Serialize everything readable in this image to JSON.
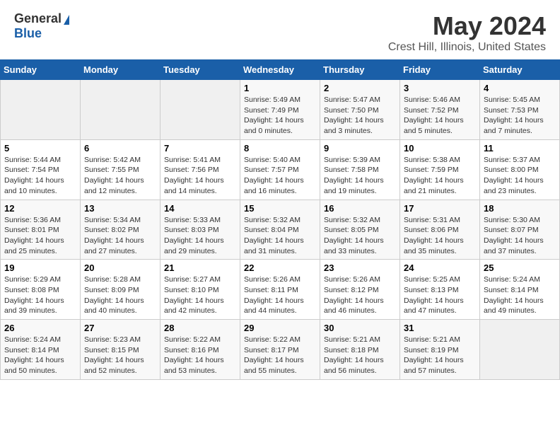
{
  "header": {
    "logo_line1": "General",
    "logo_line2": "Blue",
    "main_title": "May 2024",
    "subtitle": "Crest Hill, Illinois, United States"
  },
  "calendar": {
    "days_of_week": [
      "Sunday",
      "Monday",
      "Tuesday",
      "Wednesday",
      "Thursday",
      "Friday",
      "Saturday"
    ],
    "weeks": [
      [
        {
          "day": "",
          "info": ""
        },
        {
          "day": "",
          "info": ""
        },
        {
          "day": "",
          "info": ""
        },
        {
          "day": "1",
          "info": "Sunrise: 5:49 AM\nSunset: 7:49 PM\nDaylight: 14 hours\nand 0 minutes."
        },
        {
          "day": "2",
          "info": "Sunrise: 5:47 AM\nSunset: 7:50 PM\nDaylight: 14 hours\nand 3 minutes."
        },
        {
          "day": "3",
          "info": "Sunrise: 5:46 AM\nSunset: 7:52 PM\nDaylight: 14 hours\nand 5 minutes."
        },
        {
          "day": "4",
          "info": "Sunrise: 5:45 AM\nSunset: 7:53 PM\nDaylight: 14 hours\nand 7 minutes."
        }
      ],
      [
        {
          "day": "5",
          "info": "Sunrise: 5:44 AM\nSunset: 7:54 PM\nDaylight: 14 hours\nand 10 minutes."
        },
        {
          "day": "6",
          "info": "Sunrise: 5:42 AM\nSunset: 7:55 PM\nDaylight: 14 hours\nand 12 minutes."
        },
        {
          "day": "7",
          "info": "Sunrise: 5:41 AM\nSunset: 7:56 PM\nDaylight: 14 hours\nand 14 minutes."
        },
        {
          "day": "8",
          "info": "Sunrise: 5:40 AM\nSunset: 7:57 PM\nDaylight: 14 hours\nand 16 minutes."
        },
        {
          "day": "9",
          "info": "Sunrise: 5:39 AM\nSunset: 7:58 PM\nDaylight: 14 hours\nand 19 minutes."
        },
        {
          "day": "10",
          "info": "Sunrise: 5:38 AM\nSunset: 7:59 PM\nDaylight: 14 hours\nand 21 minutes."
        },
        {
          "day": "11",
          "info": "Sunrise: 5:37 AM\nSunset: 8:00 PM\nDaylight: 14 hours\nand 23 minutes."
        }
      ],
      [
        {
          "day": "12",
          "info": "Sunrise: 5:36 AM\nSunset: 8:01 PM\nDaylight: 14 hours\nand 25 minutes."
        },
        {
          "day": "13",
          "info": "Sunrise: 5:34 AM\nSunset: 8:02 PM\nDaylight: 14 hours\nand 27 minutes."
        },
        {
          "day": "14",
          "info": "Sunrise: 5:33 AM\nSunset: 8:03 PM\nDaylight: 14 hours\nand 29 minutes."
        },
        {
          "day": "15",
          "info": "Sunrise: 5:32 AM\nSunset: 8:04 PM\nDaylight: 14 hours\nand 31 minutes."
        },
        {
          "day": "16",
          "info": "Sunrise: 5:32 AM\nSunset: 8:05 PM\nDaylight: 14 hours\nand 33 minutes."
        },
        {
          "day": "17",
          "info": "Sunrise: 5:31 AM\nSunset: 8:06 PM\nDaylight: 14 hours\nand 35 minutes."
        },
        {
          "day": "18",
          "info": "Sunrise: 5:30 AM\nSunset: 8:07 PM\nDaylight: 14 hours\nand 37 minutes."
        }
      ],
      [
        {
          "day": "19",
          "info": "Sunrise: 5:29 AM\nSunset: 8:08 PM\nDaylight: 14 hours\nand 39 minutes."
        },
        {
          "day": "20",
          "info": "Sunrise: 5:28 AM\nSunset: 8:09 PM\nDaylight: 14 hours\nand 40 minutes."
        },
        {
          "day": "21",
          "info": "Sunrise: 5:27 AM\nSunset: 8:10 PM\nDaylight: 14 hours\nand 42 minutes."
        },
        {
          "day": "22",
          "info": "Sunrise: 5:26 AM\nSunset: 8:11 PM\nDaylight: 14 hours\nand 44 minutes."
        },
        {
          "day": "23",
          "info": "Sunrise: 5:26 AM\nSunset: 8:12 PM\nDaylight: 14 hours\nand 46 minutes."
        },
        {
          "day": "24",
          "info": "Sunrise: 5:25 AM\nSunset: 8:13 PM\nDaylight: 14 hours\nand 47 minutes."
        },
        {
          "day": "25",
          "info": "Sunrise: 5:24 AM\nSunset: 8:14 PM\nDaylight: 14 hours\nand 49 minutes."
        }
      ],
      [
        {
          "day": "26",
          "info": "Sunrise: 5:24 AM\nSunset: 8:14 PM\nDaylight: 14 hours\nand 50 minutes."
        },
        {
          "day": "27",
          "info": "Sunrise: 5:23 AM\nSunset: 8:15 PM\nDaylight: 14 hours\nand 52 minutes."
        },
        {
          "day": "28",
          "info": "Sunrise: 5:22 AM\nSunset: 8:16 PM\nDaylight: 14 hours\nand 53 minutes."
        },
        {
          "day": "29",
          "info": "Sunrise: 5:22 AM\nSunset: 8:17 PM\nDaylight: 14 hours\nand 55 minutes."
        },
        {
          "day": "30",
          "info": "Sunrise: 5:21 AM\nSunset: 8:18 PM\nDaylight: 14 hours\nand 56 minutes."
        },
        {
          "day": "31",
          "info": "Sunrise: 5:21 AM\nSunset: 8:19 PM\nDaylight: 14 hours\nand 57 minutes."
        },
        {
          "day": "",
          "info": ""
        }
      ]
    ]
  }
}
